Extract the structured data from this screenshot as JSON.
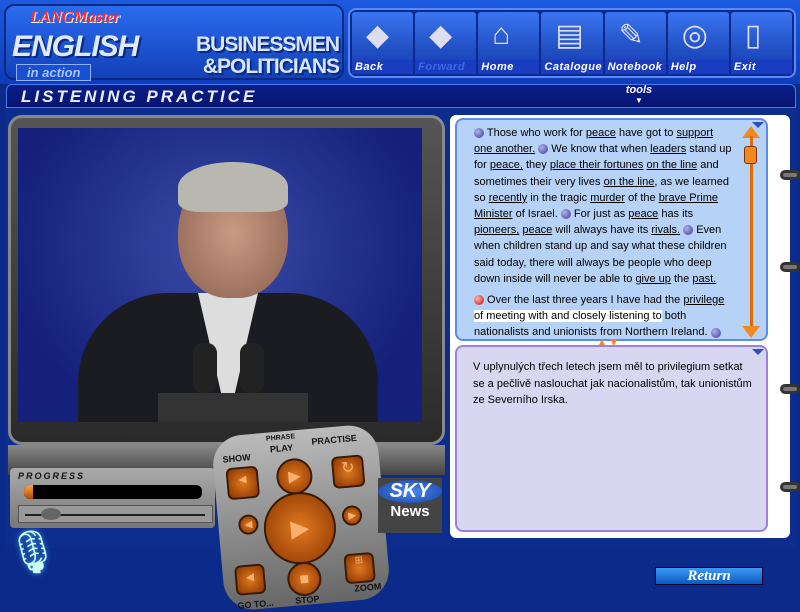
{
  "brand": {
    "publisher": "LANGMaster",
    "series": "ENGLISH",
    "series_sub": "in action",
    "course_line1": "BUSINESSMEN",
    "course_line2": "&POLITICIANS"
  },
  "nav": [
    {
      "label": "Back",
      "icon": "back-icon",
      "glyph": "◆",
      "enabled": true
    },
    {
      "label": "Forward",
      "icon": "forward-icon",
      "glyph": "◆",
      "enabled": false
    },
    {
      "label": "Home",
      "icon": "home-icon",
      "glyph": "⌂",
      "enabled": true
    },
    {
      "label": "Catalogue",
      "icon": "catalogue-icon",
      "glyph": "▤",
      "enabled": true
    },
    {
      "label": "Notebook",
      "icon": "notebook-icon",
      "glyph": "✎",
      "enabled": true
    },
    {
      "label": "Help",
      "icon": "lifebuoy-icon",
      "glyph": "◎",
      "enabled": true
    },
    {
      "label": "Exit",
      "icon": "exit-door-icon",
      "glyph": "▯",
      "enabled": true
    }
  ],
  "page": {
    "title": "LISTENING PRACTICE",
    "tools_label": "tools"
  },
  "progress": {
    "label": "PROGRESS",
    "value_percent": 5,
    "slider_percent": 10
  },
  "remote": {
    "show": "SHOW",
    "phrase": "PHRASE",
    "play": "PLAY",
    "practise": "PRACTISE",
    "stop": "STOP",
    "zoom": "ZOOM",
    "goto": "GO TO..."
  },
  "logo": {
    "sky": "SKY",
    "news": "News"
  },
  "passage": {
    "paragraphs": [
      [
        {
          "k": "bullet"
        },
        {
          "k": "text",
          "t": " Those who work for "
        },
        {
          "k": "link",
          "t": "peace"
        },
        {
          "k": "text",
          "t": "  have got to "
        },
        {
          "k": "link",
          "t": "support one another."
        },
        {
          "k": "text",
          "t": " "
        },
        {
          "k": "bullet"
        },
        {
          "k": "text",
          "t": " We know that when "
        },
        {
          "k": "link",
          "t": "leaders"
        },
        {
          "k": "text",
          "t": " stand up for "
        },
        {
          "k": "link",
          "t": "peace,"
        },
        {
          "k": "text",
          "t": "  they "
        },
        {
          "k": "link",
          "t": "place their fortunes"
        },
        {
          "k": "text",
          "t": " "
        },
        {
          "k": "link",
          "t": "on the line"
        },
        {
          "k": "text",
          "t": " and sometimes their very lives "
        },
        {
          "k": "link",
          "t": "on the line,"
        },
        {
          "k": "text",
          "t": "  as we learned so "
        },
        {
          "k": "link",
          "t": "recently"
        },
        {
          "k": "text",
          "t": " in the tragic "
        },
        {
          "k": "link",
          "t": "murder"
        },
        {
          "k": "text",
          "t": " of the "
        },
        {
          "k": "link",
          "t": "brave Prime Minister"
        },
        {
          "k": "text",
          "t": " of Israel. "
        },
        {
          "k": "bullet"
        },
        {
          "k": "text",
          "t": " For just as "
        },
        {
          "k": "link",
          "t": "peace"
        },
        {
          "k": "text",
          "t": " has its "
        },
        {
          "k": "link",
          "t": "pioneers,"
        },
        {
          "k": "text",
          "t": "  "
        },
        {
          "k": "link",
          "t": "peace"
        },
        {
          "k": "text",
          "t": " will always have its "
        },
        {
          "k": "link",
          "t": "rivals."
        },
        {
          "k": "text",
          "t": " "
        },
        {
          "k": "bullet"
        },
        {
          "k": "text",
          "t": " Even when children stand up  and say what these children said today,  there will always be people who deep down inside  will never be able to "
        },
        {
          "k": "link",
          "t": "give up"
        },
        {
          "k": "text",
          "t": " the "
        },
        {
          "k": "link",
          "t": "past."
        }
      ],
      [
        {
          "k": "bullet-active"
        },
        {
          "k": "text",
          "t": " Over the last three years I have had the "
        },
        {
          "k": "link",
          "t": "privilege"
        },
        {
          "k": "text",
          "t": " "
        },
        {
          "k": "highlight",
          "t": " of meeting with and closely listening to"
        },
        {
          "k": "text",
          "t": "  both nationalists and unionists from Northern Ireland. "
        },
        {
          "k": "bullet"
        }
      ]
    ]
  },
  "translation": "V uplynulých třech letech jsem měl to privilegium setkat se a pečlivě naslouchat jak nacionalistům, tak unionistům ze Severního Irska.",
  "return_label": "Return",
  "colors": {
    "accent": "#f08a20",
    "text_panel": "#b6d2f7",
    "translation_panel": "#d8d6f0",
    "header": "#1c5ae0"
  }
}
